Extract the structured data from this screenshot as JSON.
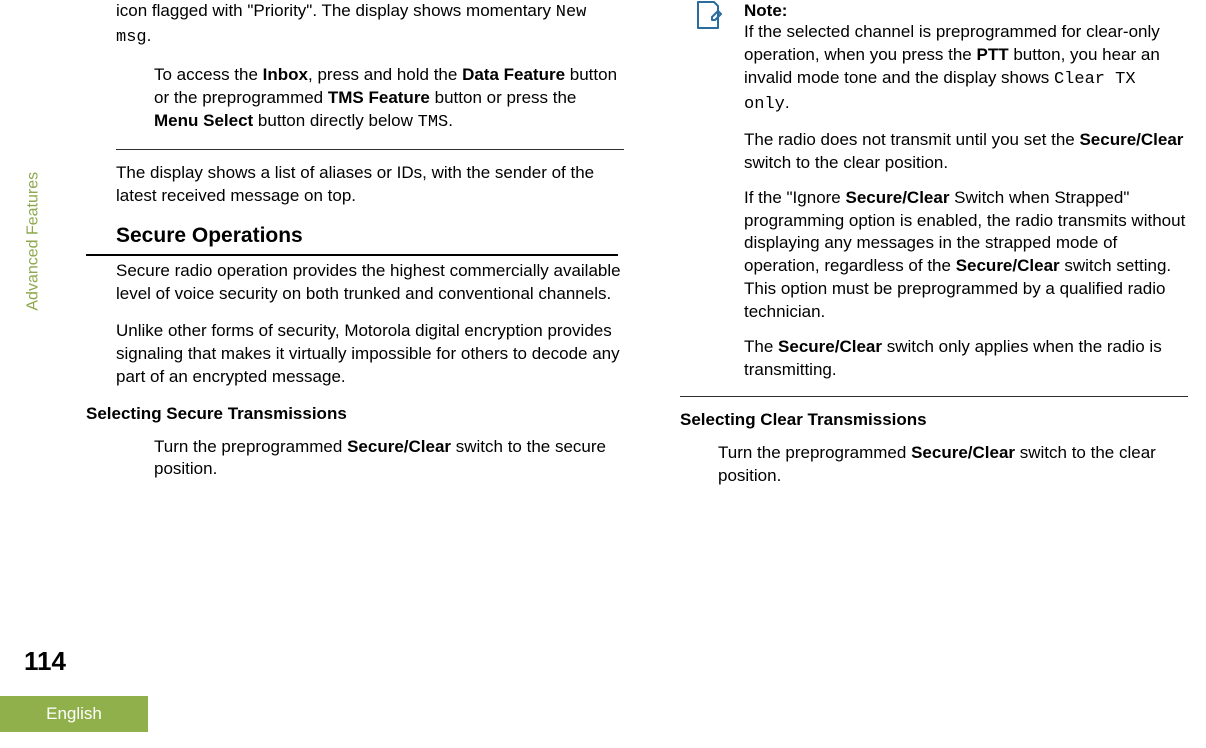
{
  "page": {
    "sidebar_label": "Advanced Features",
    "page_number": "114",
    "language": "English"
  },
  "left": {
    "p1a": "icon flagged with \"Priority\". The display shows momentary ",
    "p1_code": "New msg",
    "p1b": ".",
    "p2a": "To access the ",
    "p2_bold1": "Inbox",
    "p2b": ", press and hold the ",
    "p2_bold2": "Data Feature",
    "p2c": " button or the preprogrammed ",
    "p2_bold3": "TMS Feature",
    "p2d": " button or press the ",
    "p2_bold4": "Menu Select",
    "p2e": " button directly below ",
    "p2_code": "TMS",
    "p2f": ".",
    "p3": "The display shows a list of aliases or IDs, with the sender of the latest received message on top.",
    "h1": "Secure Operations",
    "p4": "Secure radio operation provides the highest commercially available level of voice security on both trunked and conventional channels.",
    "p5": "Unlike other forms of security, Motorola digital encryption provides signaling that makes it virtually impossible for others to decode any part of an encrypted message.",
    "h2": "Selecting Secure Transmissions",
    "p6a": "Turn the preprogrammed ",
    "p6_bold": "Secure/Clear",
    "p6b": " switch to the secure position."
  },
  "right": {
    "note_label": "Note:",
    "n1a": "If the selected channel is preprogrammed for clear-only operation, when you press the ",
    "n1_bold": "PTT",
    "n1b": " button, you hear an invalid mode tone and the display shows ",
    "n1_code": "Clear TX only",
    "n1c": ".",
    "n2a": "The radio does not transmit until you set the ",
    "n2_bold": "Secure/Clear",
    "n2b": " switch to the clear position.",
    "n3a": "If the \"Ignore ",
    "n3_bold1": "Secure/Clear",
    "n3b": " Switch when Strapped\" programming option is enabled, the radio transmits without displaying any messages in the strapped mode of operation, regardless of the ",
    "n3_bold2": "Secure/Clear",
    "n3c": " switch setting. This option must be preprogrammed by a qualified radio technician.",
    "n4a": "The ",
    "n4_bold": "Secure/Clear",
    "n4b": " switch only applies when the radio is transmitting.",
    "h2": "Selecting Clear Transmissions",
    "p1a": "Turn the preprogrammed ",
    "p1_bold": "Secure/Clear",
    "p1b": " switch to the clear position."
  }
}
